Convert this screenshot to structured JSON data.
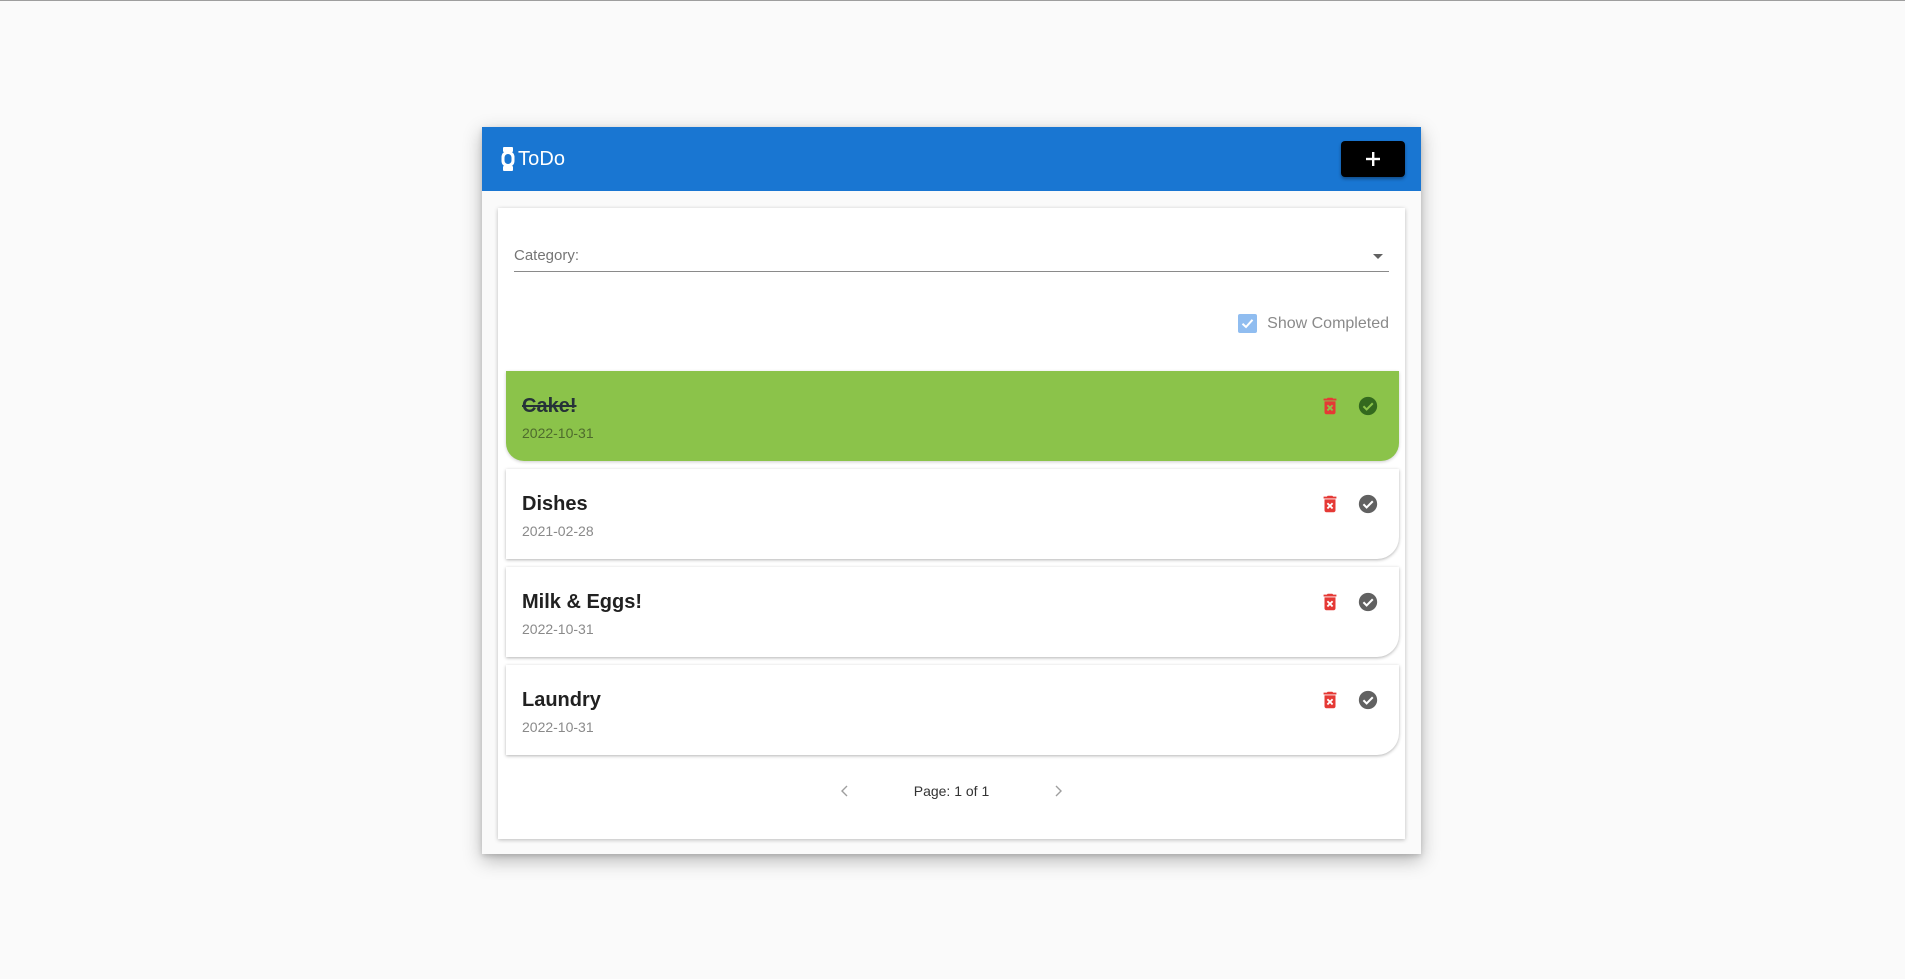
{
  "app": {
    "title": "ToDo",
    "add_label": "+"
  },
  "filter": {
    "category_label": "Category:",
    "show_completed_label": "Show Completed",
    "show_completed": true
  },
  "todos": [
    {
      "title": "Cake!",
      "date": "2022-10-31",
      "completed": true
    },
    {
      "title": "Dishes",
      "date": "2021-02-28",
      "completed": false
    },
    {
      "title": "Milk & Eggs!",
      "date": "2022-10-31",
      "completed": false
    },
    {
      "title": "Laundry",
      "date": "2022-10-31",
      "completed": false
    }
  ],
  "pagination": {
    "text": "Page: 1 of 1"
  },
  "colors": {
    "toolbar": "#1976d2",
    "completed_card": "#8bc34a",
    "delete_icon": "#e53935",
    "check_icon": "#616161",
    "check_icon_completed": "#33691e"
  },
  "icons": {
    "brand": "watch-icon",
    "add": "plus-icon",
    "delete": "delete-forever-icon",
    "complete": "check-circle-icon",
    "prev": "chevron-left-icon",
    "next": "chevron-right-icon"
  }
}
